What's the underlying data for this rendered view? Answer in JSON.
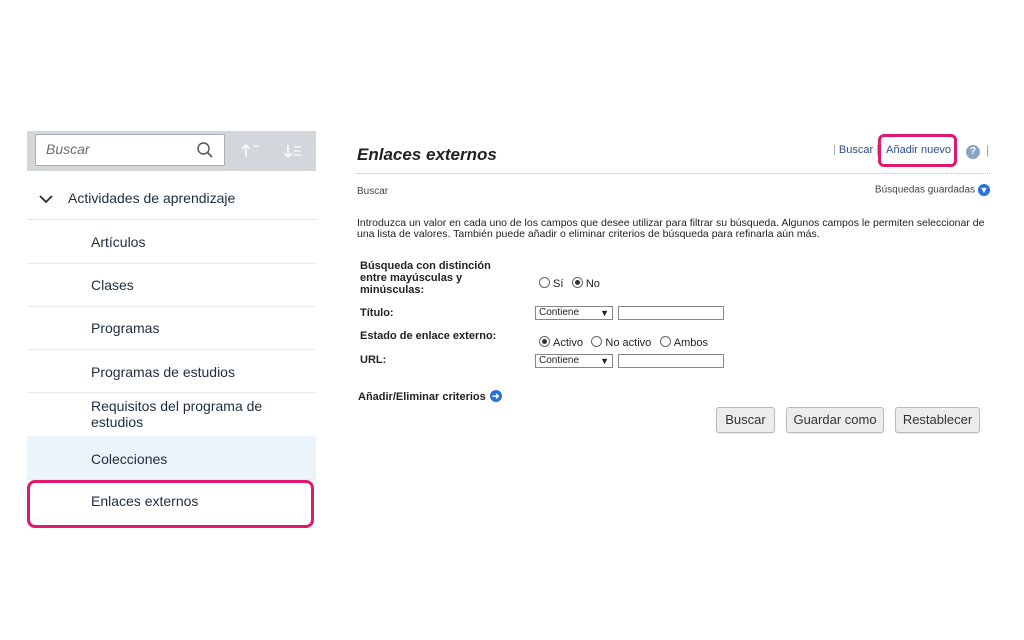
{
  "sidebar": {
    "search_placeholder": "Buscar",
    "tree_head": "Actividades de aprendizaje",
    "items": [
      {
        "label": "Artículos"
      },
      {
        "label": "Clases"
      },
      {
        "label": "Programas"
      },
      {
        "label": "Programas de estudios"
      },
      {
        "label": "Requisitos del programa de estudios"
      },
      {
        "label": "Colecciones"
      },
      {
        "label": "Enlaces externos"
      }
    ]
  },
  "main": {
    "title": "Enlaces externos",
    "links": {
      "search": "Buscar",
      "add_new": "Añadir nuevo"
    },
    "section_label": "Buscar",
    "saved_searches": "Búsquedas guardadas",
    "intro": "Introduzca un valor en cada uno de los campos que desee utilizar para filtrar su búsqueda. Algunos campos le permiten seleccionar de una lista de valores. También puede añadir o eliminar criterios de búsqueda para refinarla aún más.",
    "form": {
      "case_label": "Búsqueda con distinción entre mayúsculas y minúsculas:",
      "case_options": [
        "Sí",
        "No"
      ],
      "case_selected": "No",
      "title_label": "Título:",
      "title_operator": "Contiene",
      "title_value": "",
      "status_label": "Estado de enlace externo:",
      "status_options": [
        "Activo",
        "No activo",
        "Ambos"
      ],
      "status_selected": "Activo",
      "url_label": "URL:",
      "url_operator": "Contiene",
      "url_value": ""
    },
    "add_remove": "Añadir/Eliminar criterios",
    "buttons": {
      "search": "Buscar",
      "save_as": "Guardar como",
      "reset": "Restablecer"
    }
  },
  "colors": {
    "highlight": "#e0196e",
    "link": "#2c4e8b",
    "selected_row": "#ebf3fb",
    "toolbar": "#d3d7dc"
  }
}
